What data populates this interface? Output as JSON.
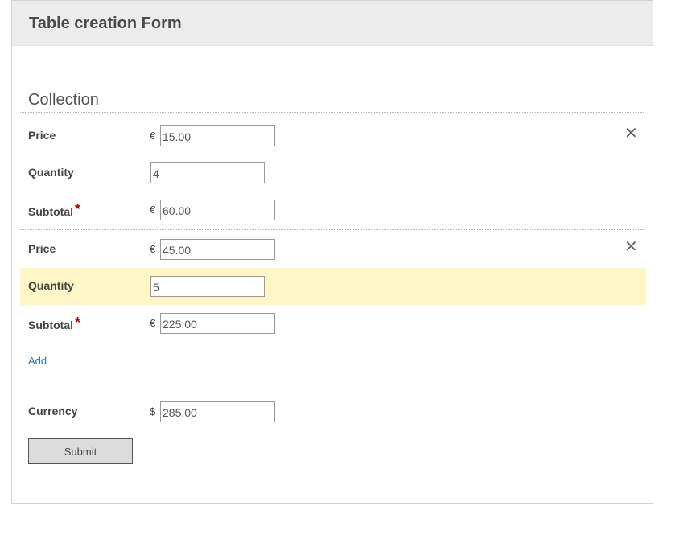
{
  "form": {
    "title": "Table creation Form",
    "section_title": "Collection",
    "items": [
      {
        "price_label": "Price",
        "price_currency": "€",
        "price_value": "15.00",
        "quantity_label": "Quantity",
        "quantity_value": "4",
        "subtotal_label": "Subtotal",
        "subtotal_currency": "€",
        "subtotal_value": "60.00",
        "remove_icon": "✕"
      },
      {
        "price_label": "Price",
        "price_currency": "€",
        "price_value": "45.00",
        "quantity_label": "Quantity",
        "quantity_value": "5",
        "subtotal_label": "Subtotal",
        "subtotal_currency": "€",
        "subtotal_value": "225.00",
        "remove_icon": "✕"
      }
    ],
    "required_marker": "*",
    "add_label": "Add",
    "currency_label": "Currency",
    "currency_symbol": "$",
    "currency_value": "285.00",
    "submit_label": "Submit"
  },
  "colors": {
    "header_bg": "#ececec",
    "highlight_bg": "#fff6c6",
    "required": "#b00000",
    "link": "#2a6fb0",
    "button_bg": "#dcdcdc"
  },
  "icons": {
    "remove": "close-icon"
  }
}
